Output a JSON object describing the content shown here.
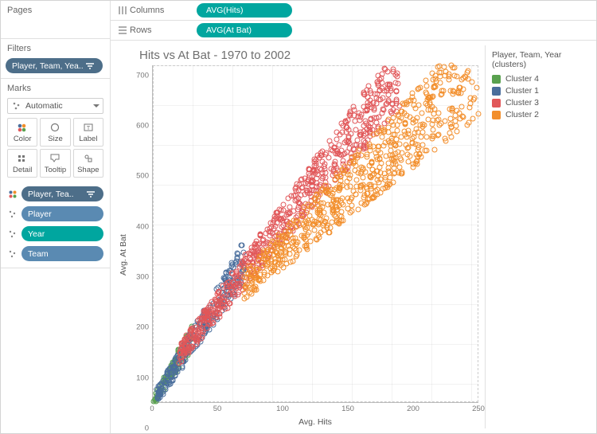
{
  "left": {
    "pages_title": "Pages",
    "filters_title": "Filters",
    "filter_pill": "Player, Team, Yea..",
    "marks_title": "Marks",
    "marks_select_label": "Automatic",
    "mark_buttons": {
      "color": "Color",
      "size": "Size",
      "label": "Label",
      "detail": "Detail",
      "tooltip": "Tooltip",
      "shape": "Shape"
    },
    "marks_pills": {
      "cluster": "Player, Tea..",
      "player": "Player",
      "year": "Year",
      "team": "Team"
    }
  },
  "shelves": {
    "columns_label": "Columns",
    "rows_label": "Rows",
    "columns_pill": "AVG(Hits)",
    "rows_pill": "AVG(At Bat)"
  },
  "chart": {
    "title": "Hits vs At Bat - 1970 to 2002",
    "xlabel": "Avg. Hits",
    "ylabel": "Avg. At Bat",
    "xticks": [
      "0",
      "50",
      "100",
      "150",
      "200",
      "250"
    ],
    "yticks": [
      "0",
      "100",
      "200",
      "300",
      "400",
      "500",
      "600",
      "700"
    ]
  },
  "legend": {
    "title": "Player, Team, Year (clusters)",
    "items": [
      {
        "label": "Cluster 4",
        "cls": "sw4"
      },
      {
        "label": "Cluster 1",
        "cls": "sw1"
      },
      {
        "label": "Cluster 3",
        "cls": "sw3"
      },
      {
        "label": "Cluster 2",
        "cls": "sw2"
      }
    ]
  },
  "chart_data": {
    "type": "scatter",
    "title": "Hits vs At Bat - 1970 to 2002",
    "xlabel": "Avg. Hits",
    "ylabel": "Avg. At Bat",
    "xlim": [
      0,
      250
    ],
    "ylim": [
      0,
      720
    ],
    "series": [
      {
        "name": "Cluster 4",
        "color": "#59a14f",
        "range_x": [
          0,
          30
        ],
        "range_y": [
          0,
          140
        ],
        "approx_slope": 4.0
      },
      {
        "name": "Cluster 1",
        "color": "#4a6e9c",
        "range_x": [
          0,
          70
        ],
        "range_y": [
          0,
          300
        ],
        "approx_slope": 4.2
      },
      {
        "name": "Cluster 3",
        "color": "#e15759",
        "range_x": [
          20,
          190
        ],
        "range_y": [
          100,
          700
        ],
        "approx_slope": 3.5
      },
      {
        "name": "Cluster 2",
        "color": "#f28e2b",
        "range_x": [
          70,
          250
        ],
        "range_y": [
          250,
          710
        ],
        "approx_slope": 2.8
      }
    ],
    "note": "Dense overlapping scatter of thousands of player-year points; individual values not labeled — series summarized by x/y range and approximate slope."
  }
}
